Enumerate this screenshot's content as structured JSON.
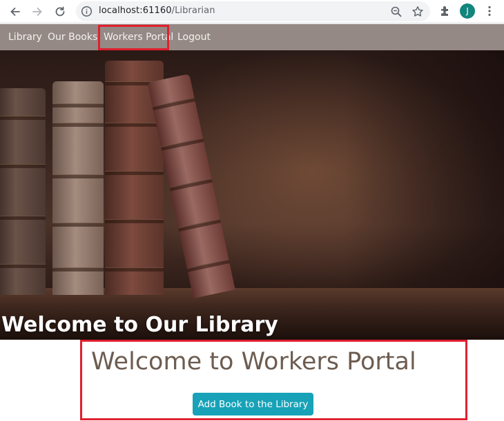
{
  "browser": {
    "url_host": "localhost:61160",
    "url_path": "/Librarian",
    "profile_initial": "J"
  },
  "navbar": {
    "items": [
      {
        "label": "Library"
      },
      {
        "label": "Our Books"
      },
      {
        "label": "Workers Portal"
      },
      {
        "label": "Logout"
      }
    ]
  },
  "hero": {
    "title": "Welcome to Our Library"
  },
  "portal": {
    "title": "Welcome to Workers Portal",
    "add_button_label": "Add Book to the Library"
  },
  "colors": {
    "navbar_bg": "#958985",
    "highlight_border": "#e0202e",
    "button_bg": "#17a2b8",
    "portal_title": "#6d5c50"
  }
}
